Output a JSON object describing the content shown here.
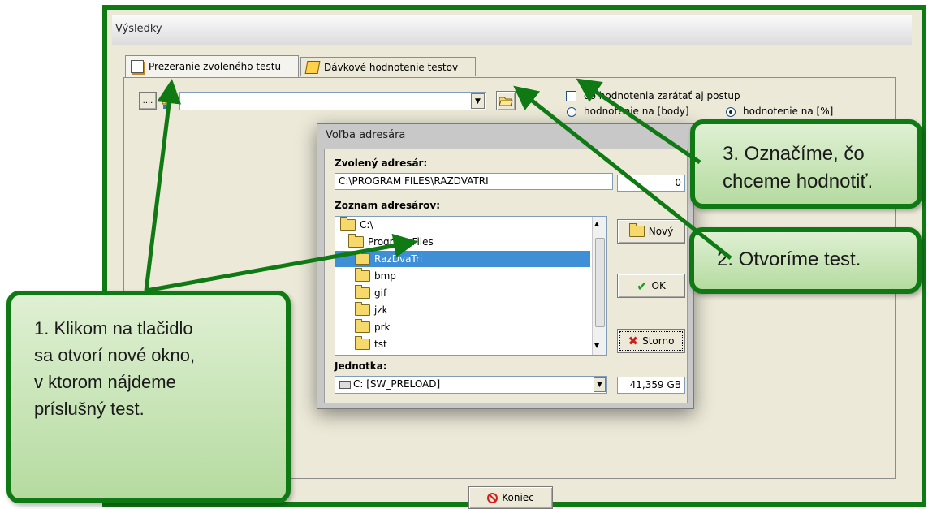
{
  "window": {
    "title": "Výsledky"
  },
  "tabs": [
    {
      "label": "Prezeranie zvoleného testu"
    },
    {
      "label": "Dávkové hodnotenie testov"
    }
  ],
  "toolbar": {
    "browse_label": "....",
    "path_value": "",
    "options": {
      "checkbox_label": "do hodnotenia zarátať aj postup",
      "radio_body_label": "hodnotenie na [body]",
      "radio_percent_label": "hodnotenie na [%]",
      "selected": "percent"
    }
  },
  "dialog": {
    "title": "Voľba adresára",
    "selected_dir_label": "Zvolený adresár:",
    "selected_dir_value": "C:\\PROGRAM FILES\\RAZDVATRI",
    "count_value": "0",
    "dir_list_label": "Zoznam adresárov:",
    "dirs": [
      {
        "name": "C:\\"
      },
      {
        "name": "Program Files"
      },
      {
        "name": "RazDvaTri"
      },
      {
        "name": "bmp"
      },
      {
        "name": "gif"
      },
      {
        "name": "jzk"
      },
      {
        "name": "prk"
      },
      {
        "name": "tst"
      }
    ],
    "new_button": "Nový",
    "ok_button": "OK",
    "cancel_button": "Storno",
    "drive_label": "Jednotka:",
    "drive_value": "C: [SW_PRELOAD]",
    "free_space": "41,359 GB"
  },
  "footer": {
    "close_button": "Koniec"
  },
  "callouts": {
    "step1": [
      "1. Klikom na tlačidlo",
      "sa otvorí nové okno,",
      "v ktorom nájdeme",
      "príslušný test."
    ],
    "step2": "2. Otvoríme test.",
    "step3": [
      "3. Označíme, čo",
      "chceme hodnotiť."
    ]
  },
  "colors": {
    "callout_border": "#0f7a14",
    "callout_fill": "#c9e6b8",
    "selection": "#3f8fd6"
  }
}
